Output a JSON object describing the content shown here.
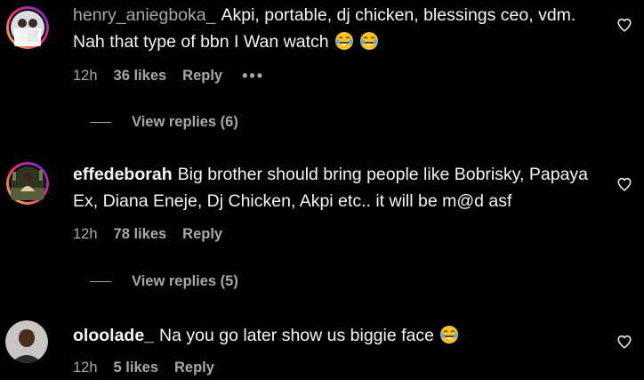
{
  "comments": [
    {
      "username": "henry_aniegboka_",
      "text": "Akpi, portable, dj chicken, blessings ceo, vdm. Nah that type of bbn I Wan watch",
      "emojis": [
        "laughing-tears-emoji",
        "laughing-tears-emoji"
      ],
      "time": "12h",
      "likes": "36 likes",
      "reply_label": "Reply",
      "more_label": "•••",
      "view_replies": "View replies (6)"
    },
    {
      "username": "effedeborah",
      "text": "Big brother should bring people like Bobrisky, Papaya Ex, Diana Eneje, Dj Chicken, Akpi etc.. it will be m@d asf",
      "time": "12h",
      "likes": "78 likes",
      "reply_label": "Reply",
      "view_replies": "View replies (5)"
    },
    {
      "username": "oloolade_",
      "text": "Na you go later show us biggie face",
      "emojis": [
        "laughing-tears-emoji"
      ],
      "time": "12h",
      "likes": "5 likes",
      "reply_label": "Reply"
    }
  ],
  "colors": {
    "background": "#000000",
    "text": "#f5f5f5",
    "muted": "#a8a8a8",
    "story_ring": "#e1306c"
  }
}
